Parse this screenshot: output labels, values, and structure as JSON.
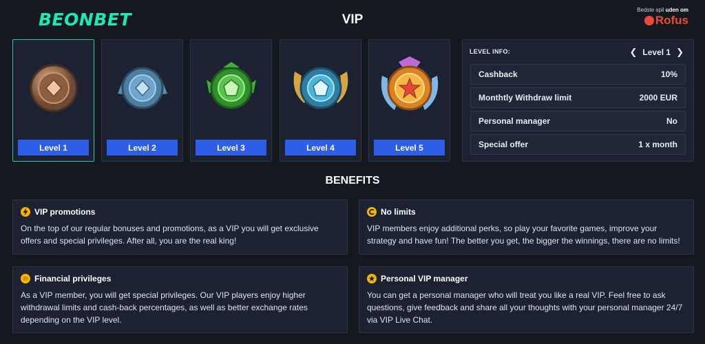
{
  "header": {
    "logo": "BEONBET",
    "title": "VIP",
    "rofus_small": "Bedste spil",
    "rofus_small_bold": "uden om",
    "rofus_brand": "Rofus"
  },
  "levels": [
    {
      "label": "Level 1",
      "tier": "bronze"
    },
    {
      "label": "Level 2",
      "tier": "steel"
    },
    {
      "label": "Level 3",
      "tier": "emerald"
    },
    {
      "label": "Level 4",
      "tier": "sapphire"
    },
    {
      "label": "Level 5",
      "tier": "gold"
    }
  ],
  "level_info": {
    "heading": "LEVEL INFO:",
    "current": "Level 1",
    "rows": [
      {
        "label": "Cashback",
        "value": "10%"
      },
      {
        "label": "Monthtly Withdraw limit",
        "value": "2000 EUR"
      },
      {
        "label": "Personal manager",
        "value": "No"
      },
      {
        "label": "Special offer",
        "value": "1 x month"
      }
    ]
  },
  "benefits": {
    "title": "BENEFITS",
    "items": [
      {
        "icon": "lightning-icon",
        "title": "VIP promotions",
        "text": "On the top of our regular bonuses and promotions, as a VIP you will get exclusive offers and special privileges. After all, you are the real king!"
      },
      {
        "icon": "coin-c-icon",
        "title": "No limits",
        "text": "VIP members enjoy additional perks, so play your favorite games, improve your strategy and have fun! The better you get, the bigger the winnings, there are no limits!"
      },
      {
        "icon": "coin-icon",
        "title": "Financial privileges",
        "text": "As a VIP member, you will get special privileges. Our VIP players enjoy higher withdrawal limits and cash-back percentages, as well as better exchange rates depending on the VIP level."
      },
      {
        "icon": "star-icon",
        "title": "Personal VIP manager",
        "text": "You can get a personal manager who will treat you like a real VIP. Feel free to ask questions, give feedback and share all your thoughts with your personal manager 24/7 via VIP Live Chat."
      }
    ]
  },
  "colors": {
    "accent": "#1de9b6",
    "button": "#2f5ee6",
    "rofus": "#e74b3c",
    "icon_gold": "#f5b400"
  }
}
